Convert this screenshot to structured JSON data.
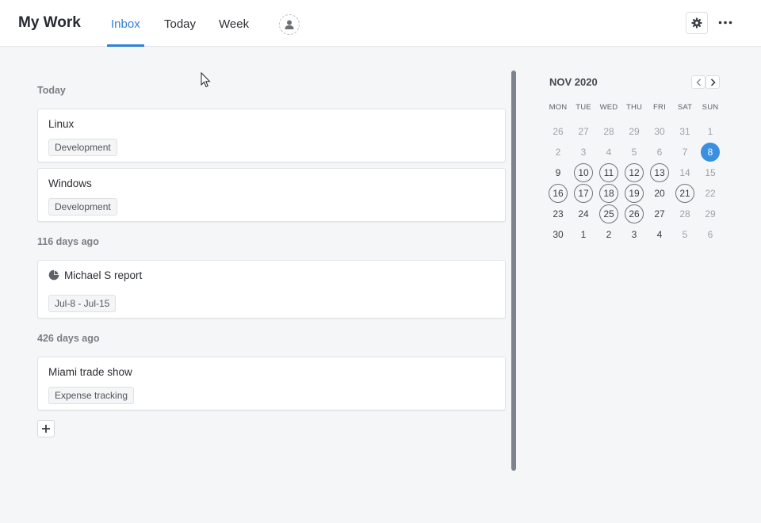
{
  "header": {
    "title": "My Work",
    "tabs": [
      {
        "label": "Inbox",
        "active": true
      },
      {
        "label": "Today",
        "active": false
      },
      {
        "label": "Week",
        "active": false
      }
    ],
    "icons": {
      "avatar": "user-icon",
      "settings": "gear-icon",
      "more": "more-horizontal-icon"
    }
  },
  "sections": [
    {
      "title": "Today",
      "cards": [
        {
          "title": "Linux",
          "tag": "Development"
        },
        {
          "title": "Windows",
          "tag": "Development"
        }
      ]
    },
    {
      "title": "116 days ago",
      "cards": [
        {
          "title": "Michael S report",
          "tag": "Jul-8 - Jul-15",
          "icon": "pie-chart-icon"
        }
      ]
    },
    {
      "title": "426 days ago",
      "cards": [
        {
          "title": "Miami trade show",
          "tag": "Expense tracking"
        }
      ]
    }
  ],
  "add_button_icon": "plus-icon",
  "calendar": {
    "month_label": "NOV 2020",
    "weekdays": [
      "MON",
      "TUE",
      "WED",
      "THU",
      "FRI",
      "SAT",
      "SUN"
    ],
    "weeks": [
      [
        "26",
        "27",
        "28",
        "29",
        "30",
        "31",
        "1"
      ],
      [
        "2",
        "3",
        "4",
        "5",
        "6",
        "7",
        "8"
      ],
      [
        "9",
        "10",
        "11",
        "12",
        "13",
        "14",
        "15"
      ],
      [
        "16",
        "17",
        "18",
        "19",
        "20",
        "21",
        "22"
      ],
      [
        "23",
        "24",
        "25",
        "26",
        "27",
        "28",
        "29"
      ],
      [
        "30",
        "1",
        "2",
        "3",
        "4",
        "5",
        "6"
      ]
    ],
    "selected_day": "8",
    "accent_color": "#3b8fe0"
  },
  "colors": {
    "accent": "#2f80d6",
    "background": "#f5f6f8"
  }
}
